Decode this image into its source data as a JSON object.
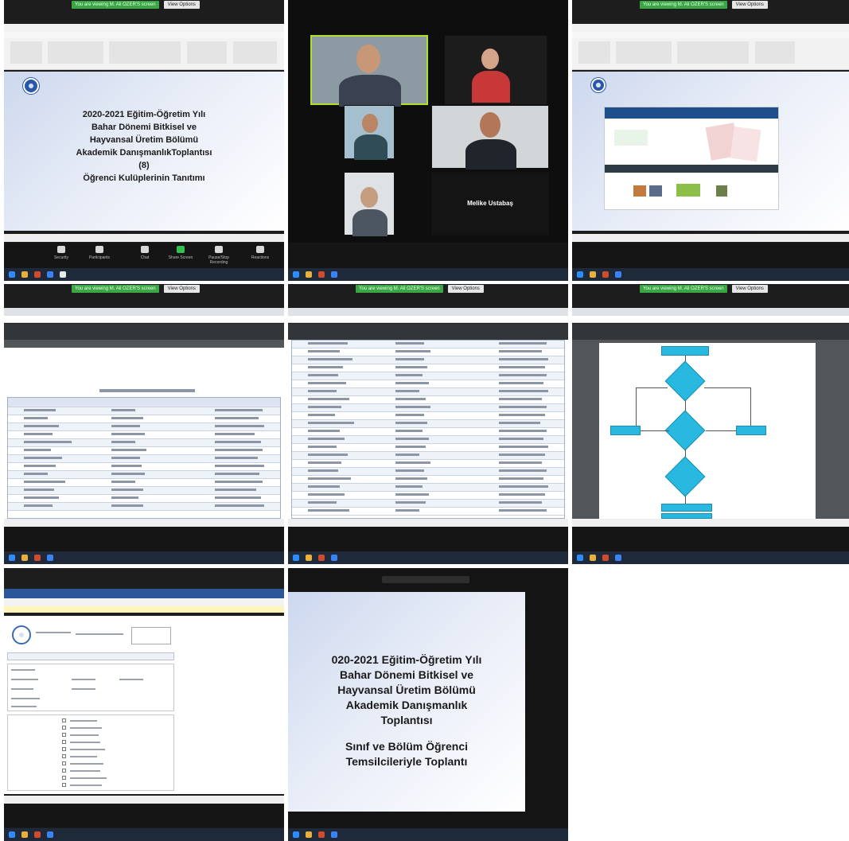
{
  "zoom": {
    "share_banner": "You are viewing M. Ali OZER'S screen",
    "view_options": "View Options",
    "controls": [
      "Security",
      "Participants",
      "Chat",
      "Share Screen",
      "Pause/Stop Recording",
      "Reactions"
    ]
  },
  "slide1": {
    "lines": [
      "2020-2021 Eğitim-Öğretim Yılı",
      "Bahar Dönemi Bitkisel ve",
      "Hayvansal Üretim Bölümü",
      "Akademik DanışmanlıkToplantısı",
      "(8)",
      "Öğrenci Kulüplerinin Tanıtımı"
    ]
  },
  "meeting": {
    "participant_label": "Melike Ustabaş"
  },
  "slide2": {
    "lines": [
      "020-2021 Eğitim-Öğretim Yılı",
      "Bahar Dönemi Bitkisel ve",
      "Hayvansal Üretim Bölümü",
      "Akademik Danışmanlık",
      "Toplantısı",
      "",
      "Sınıf ve Bölüm Öğrenci",
      "Temsilcileriyle Toplantı"
    ]
  },
  "colors": {
    "zoom_dark": "#151515",
    "share_green": "#3aa744",
    "flow_cyan": "#29b8e0",
    "ppt_red": "#c14f3a"
  }
}
